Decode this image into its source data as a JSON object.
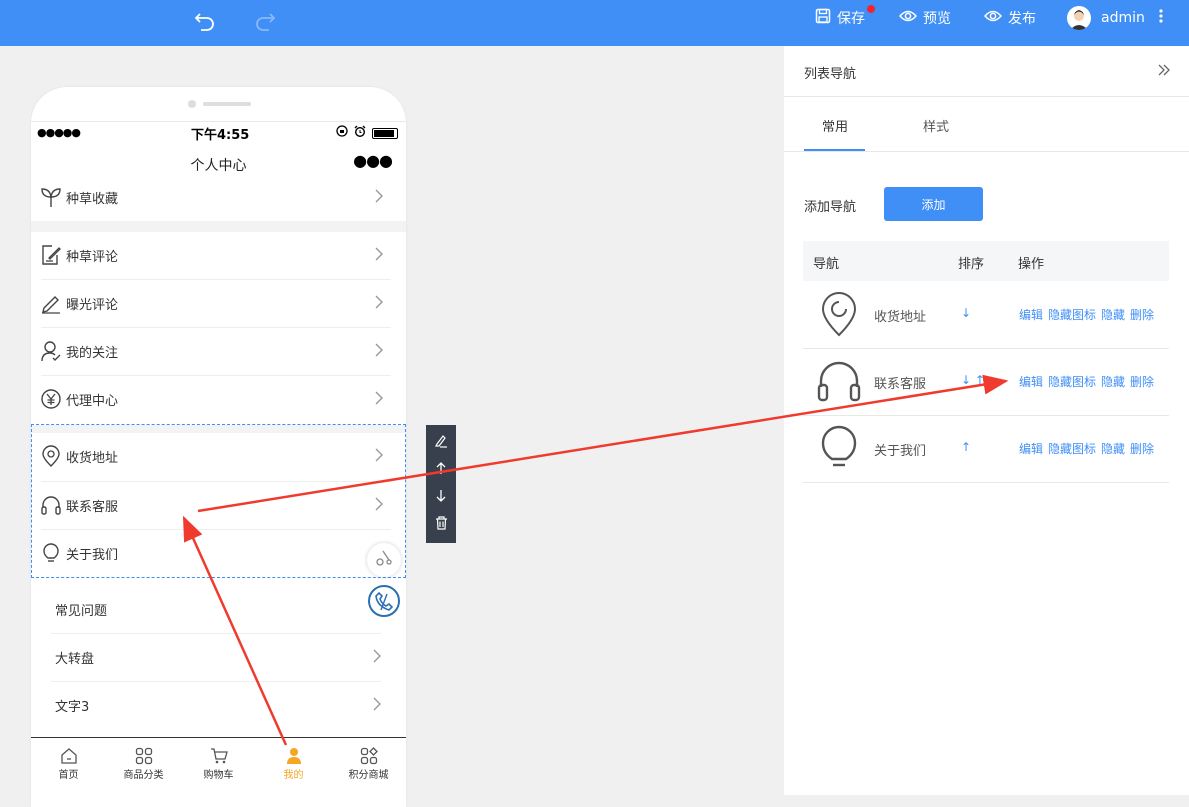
{
  "topbar": {
    "save": "保存",
    "preview": "预览",
    "publish": "发布",
    "user": "admin",
    "bg_color": "#3f8ff7",
    "badge_color": "#f5222d"
  },
  "phone": {
    "status_time": "下午4:55",
    "status_dots": "●●●●●",
    "nav_title": "个人中心",
    "nav_more": "●●●",
    "menu_items": [
      {
        "label": "种草收藏",
        "icon": "sprout-icon"
      },
      {
        "label": "种草评论",
        "icon": "edit-note-icon"
      },
      {
        "label": "曝光评论",
        "icon": "pen-icon"
      },
      {
        "label": "我的关注",
        "icon": "user-check-icon"
      },
      {
        "label": "代理中心",
        "icon": "yen-icon"
      },
      {
        "label": "收货地址",
        "icon": "location-icon"
      },
      {
        "label": "联系客服",
        "icon": "headset-icon"
      },
      {
        "label": "关于我们",
        "icon": "bulb-icon"
      }
    ],
    "card_items": [
      {
        "label": "常见问题"
      },
      {
        "label": "大转盘"
      },
      {
        "label": "文字3"
      }
    ],
    "tabs": [
      {
        "label": "首页",
        "icon": "home-icon"
      },
      {
        "label": "商品分类",
        "icon": "grid-icon"
      },
      {
        "label": "购物车",
        "icon": "cart-icon"
      },
      {
        "label": "我的",
        "icon": "person-icon"
      },
      {
        "label": "积分商城",
        "icon": "points-icon"
      }
    ],
    "active_tab_color": "#f5a623"
  },
  "panel": {
    "title": "列表导航",
    "tabs": [
      {
        "label": "常用"
      },
      {
        "label": "样式"
      }
    ],
    "add_label": "添加导航",
    "add_button": "添加",
    "columns": [
      "导航",
      "排序",
      "操作"
    ],
    "rows": [
      {
        "name": "收货地址",
        "sort": "↓",
        "icon": "location-icon",
        "ops": [
          "编辑",
          "隐藏图标",
          "隐藏",
          "删除"
        ]
      },
      {
        "name": "联系客服",
        "sort": "↓ ↑",
        "icon": "headset-icon",
        "ops": [
          "编辑",
          "隐藏图标",
          "隐藏",
          "删除"
        ]
      },
      {
        "name": "关于我们",
        "sort": "↑",
        "icon": "bulb-icon",
        "ops": [
          "编辑",
          "隐藏图标",
          "隐藏",
          "删除"
        ]
      }
    ],
    "link_color": "#3f8ff7"
  },
  "annotation": {
    "arrow_color": "#f03a2e"
  }
}
